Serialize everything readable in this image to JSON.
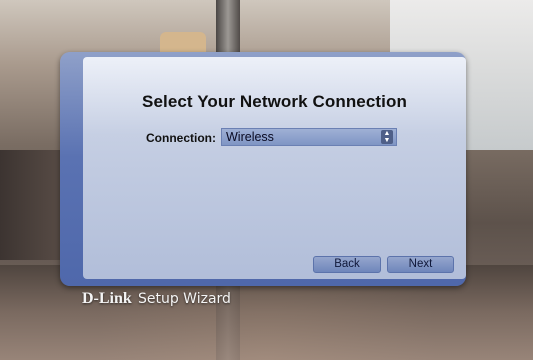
{
  "dialog": {
    "title": "Select Your Network Connection",
    "connection_label": "Connection:",
    "connection_value": "Wireless",
    "back_label": "Back",
    "next_label": "Next"
  },
  "branding": {
    "logo_text": "D-Link",
    "product_text": "Setup Wizard"
  },
  "colors": {
    "frame": "#5a72b2",
    "button": "#7f95c4"
  },
  "icons": {
    "select_arrow": "up-down-arrows-icon"
  }
}
